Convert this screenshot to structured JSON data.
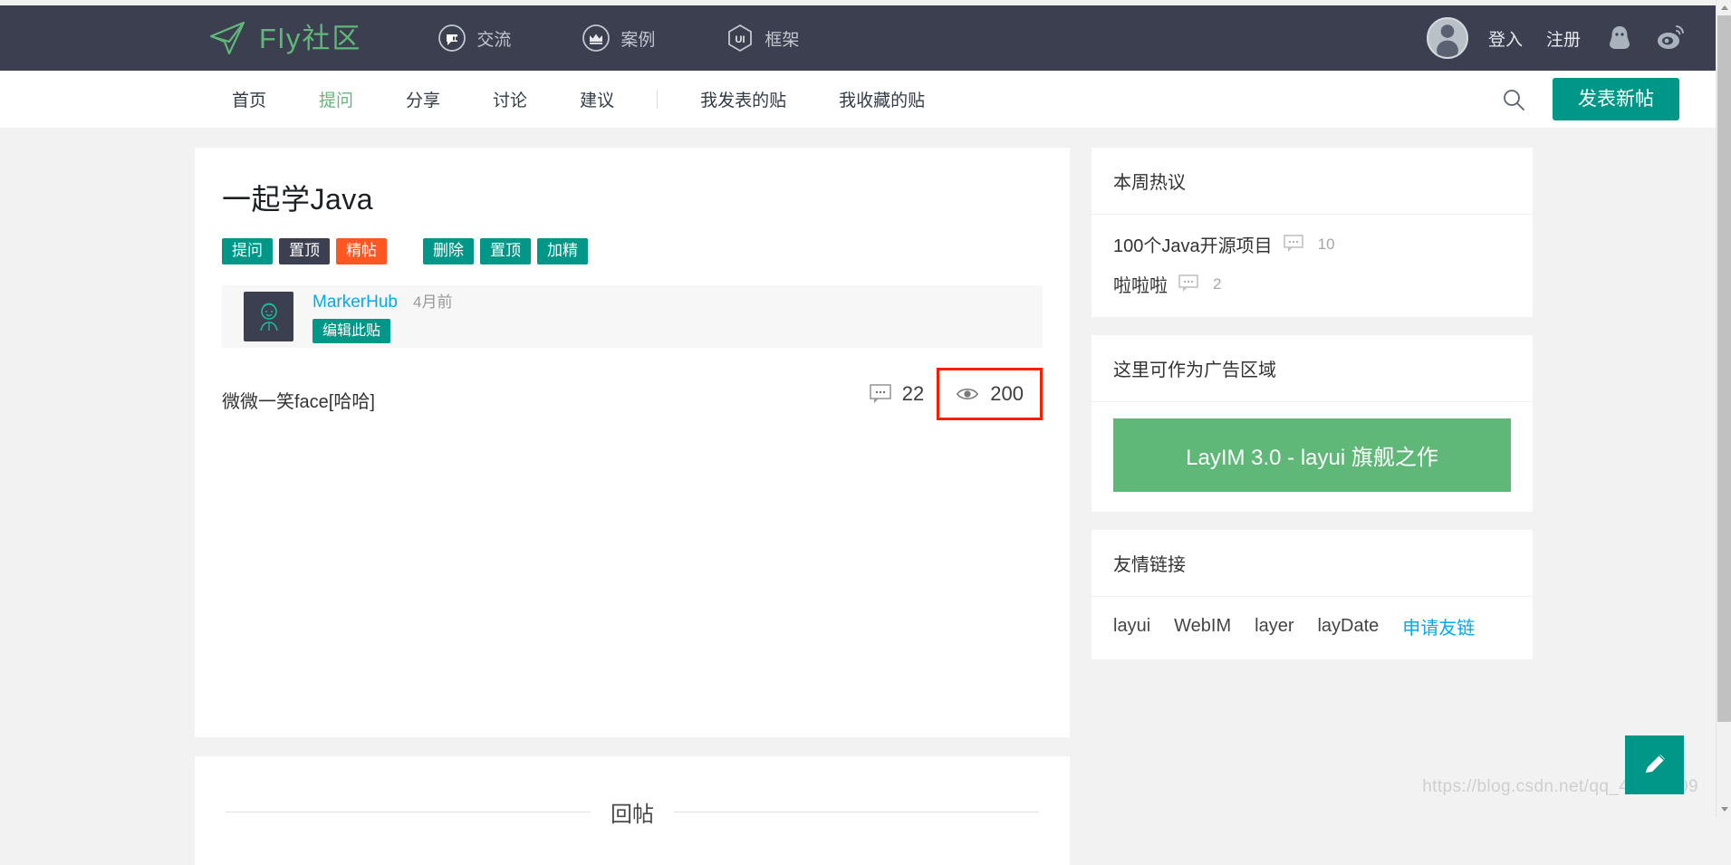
{
  "header": {
    "brand": "Fly社区",
    "brand_color": "#5fb878",
    "nav": [
      {
        "label": "交流",
        "icon": "chat-bubble-icon"
      },
      {
        "label": "案例",
        "icon": "crown-icon"
      },
      {
        "label": "框架",
        "icon": "ui-hexagon-icon"
      }
    ],
    "login_label": "登入",
    "register_label": "注册",
    "icons": [
      "user-avatar-icon",
      "qq-penguin-icon",
      "weibo-icon"
    ]
  },
  "subnav": {
    "items": [
      {
        "label": "首页",
        "active": false
      },
      {
        "label": "提问",
        "active": true
      },
      {
        "label": "分享",
        "active": false
      },
      {
        "label": "讨论",
        "active": false
      },
      {
        "label": "建议",
        "active": false
      }
    ],
    "items2": [
      {
        "label": "我发表的贴"
      },
      {
        "label": "我收藏的贴"
      }
    ],
    "search_icon": "search-icon",
    "new_post_label": "发表新帖",
    "accent_color": "#009688"
  },
  "post": {
    "title": "一起学Java",
    "badges": [
      {
        "label": "提问",
        "color": "#009688"
      },
      {
        "label": "置顶",
        "color": "#3b3f4f"
      },
      {
        "label": "精帖",
        "color": "#ff5722"
      }
    ],
    "ops": [
      {
        "label": "删除"
      },
      {
        "label": "置顶"
      },
      {
        "label": "加精"
      }
    ],
    "comment_count": "22",
    "view_count": "200",
    "highlight_color": "#fc1d00",
    "author": {
      "name": "MarkerHub",
      "time": "4月前",
      "edit_label": "编辑此贴"
    },
    "body": "微微一笑face[哈哈]"
  },
  "reply_section": {
    "title": "回帖"
  },
  "sidebar": {
    "hot": {
      "title": "本周热议",
      "items": [
        {
          "title": "100个Java开源项目",
          "count": "10"
        },
        {
          "title": "啦啦啦",
          "count": "2"
        }
      ]
    },
    "ad": {
      "title": "这里可作为广告区域",
      "banner_text": "LayIM 3.0 - layui 旗舰之作",
      "banner_color": "#5FB878"
    },
    "links": {
      "title": "友情链接",
      "items": [
        "layui",
        "WebIM",
        "layer",
        "layDate"
      ],
      "apply_label": "申请友链"
    }
  },
  "floating": {
    "icon": "pencil-icon"
  },
  "watermark": "https://blog.csdn.net/qq_43568109"
}
